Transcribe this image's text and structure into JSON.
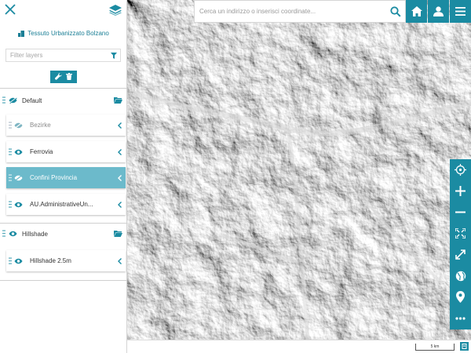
{
  "sidebar": {
    "title": "Tessuto Urbanizzato Bolzano",
    "filter_placeholder": "Filter layers",
    "groups": [
      {
        "label": "Default",
        "visibility": "hidden",
        "layers": [
          {
            "label": "Bezirke",
            "visibility": "hidden",
            "state": "dimmed"
          },
          {
            "label": "Ferrovia",
            "visibility": "visible",
            "state": "normal"
          },
          {
            "label": "Confini Provincia",
            "visibility": "hidden",
            "state": "selected"
          },
          {
            "label": "AU.AdministrativeUn...",
            "visibility": "visible",
            "state": "normal"
          }
        ]
      },
      {
        "label": "Hillshade",
        "visibility": "visible",
        "layers": [
          {
            "label": "Hillshade 2.5m",
            "visibility": "visible",
            "state": "normal"
          }
        ]
      }
    ]
  },
  "search": {
    "placeholder": "Cerca un indirizzo o inserisci coordinate..."
  },
  "top_buttons": [
    "home-icon",
    "user-icon",
    "menu-icon"
  ],
  "map_toolbar": [
    "locate-icon",
    "zoom-in-icon",
    "zoom-out-icon",
    "fullscreen-icon",
    "zoom-extent-icon",
    "globe-icon",
    "location-pin-icon",
    "more-icon"
  ],
  "scale": {
    "label": "5 km"
  },
  "basemap": "hillshade relief",
  "colors": {
    "accent": "#1b8ba2",
    "selected_layer": "#6cbacb",
    "title": "#1b7f96"
  }
}
